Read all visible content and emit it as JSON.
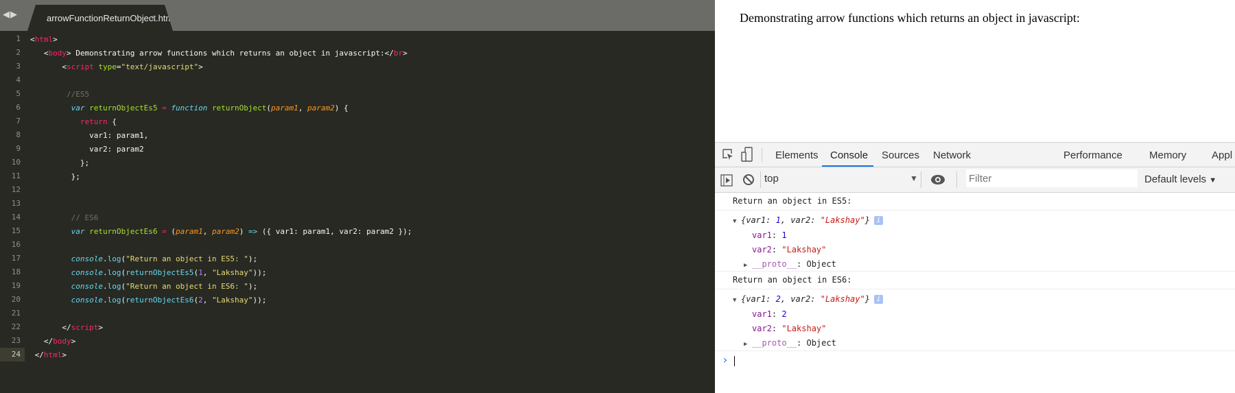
{
  "editor": {
    "tab_title": "arrowFunctionReturnObject.html",
    "close_glyph": "×",
    "nav_glyph": "◀▶",
    "current_line": 24,
    "lines": [
      [
        [
          "<",
          "src"
        ],
        [
          "html",
          "tag"
        ],
        [
          ">",
          "src"
        ]
      ],
      [
        [
          "   <",
          "src"
        ],
        [
          "body",
          "tag"
        ],
        [
          "> Demonstrating arrow functions which returns an object in javascript:</",
          "src"
        ],
        [
          "br",
          "tag"
        ],
        [
          ">",
          "src"
        ]
      ],
      [
        [
          "       <",
          "src"
        ],
        [
          "script",
          "tag"
        ],
        [
          " ",
          "src"
        ],
        [
          "type",
          "attr"
        ],
        [
          "=",
          "src"
        ],
        [
          "\"text/javascript\"",
          "str"
        ],
        [
          ">",
          "src"
        ]
      ],
      [],
      [
        [
          "        //ES5",
          "cmt"
        ]
      ],
      [
        [
          "         ",
          "src"
        ],
        [
          "var",
          "kw"
        ],
        [
          " ",
          "src"
        ],
        [
          "returnObjectEs5",
          "fn"
        ],
        [
          " ",
          "src"
        ],
        [
          "=",
          "op"
        ],
        [
          " ",
          "src"
        ],
        [
          "function",
          "kw"
        ],
        [
          " ",
          "src"
        ],
        [
          "returnObject",
          "fn"
        ],
        [
          "(",
          "src"
        ],
        [
          "param1",
          "prm"
        ],
        [
          ", ",
          "src"
        ],
        [
          "param2",
          "prm"
        ],
        [
          ") {",
          "src"
        ]
      ],
      [
        [
          "           ",
          "src"
        ],
        [
          "return",
          "ret"
        ],
        [
          " {",
          "src"
        ]
      ],
      [
        [
          "             var1: param1,",
          "src"
        ]
      ],
      [
        [
          "             var2: param2",
          "src"
        ]
      ],
      [
        [
          "           };",
          "src"
        ]
      ],
      [
        [
          "         };",
          "src"
        ]
      ],
      [],
      [],
      [
        [
          "         // ES6",
          "cmt"
        ]
      ],
      [
        [
          "         ",
          "src"
        ],
        [
          "var",
          "kw"
        ],
        [
          " ",
          "src"
        ],
        [
          "returnObjectEs6",
          "fn"
        ],
        [
          " ",
          "src"
        ],
        [
          "=",
          "op"
        ],
        [
          " (",
          "src"
        ],
        [
          "param1",
          "prm"
        ],
        [
          ", ",
          "src"
        ],
        [
          "param2",
          "prm"
        ],
        [
          ") ",
          "src"
        ],
        [
          "=>",
          "arrow"
        ],
        [
          " ({ var1: param1, var2: param2 });",
          "src"
        ]
      ],
      [],
      [
        [
          "         ",
          "src"
        ],
        [
          "console",
          "kw"
        ],
        [
          ".",
          "src"
        ],
        [
          "log",
          "call"
        ],
        [
          "(",
          "src"
        ],
        [
          "\"Return an object in ES5: \"",
          "str"
        ],
        [
          ");",
          "src"
        ]
      ],
      [
        [
          "         ",
          "src"
        ],
        [
          "console",
          "kw"
        ],
        [
          ".",
          "src"
        ],
        [
          "log",
          "call"
        ],
        [
          "(",
          "src"
        ],
        [
          "returnObjectEs5",
          "call"
        ],
        [
          "(",
          "src"
        ],
        [
          "1",
          "num2"
        ],
        [
          ", ",
          "src"
        ],
        [
          "\"Lakshay\"",
          "str"
        ],
        [
          "));",
          "src"
        ]
      ],
      [
        [
          "         ",
          "src"
        ],
        [
          "console",
          "kw"
        ],
        [
          ".",
          "src"
        ],
        [
          "log",
          "call"
        ],
        [
          "(",
          "src"
        ],
        [
          "\"Return an object in ES6: \"",
          "str"
        ],
        [
          ");",
          "src"
        ]
      ],
      [
        [
          "         ",
          "src"
        ],
        [
          "console",
          "kw"
        ],
        [
          ".",
          "src"
        ],
        [
          "log",
          "call"
        ],
        [
          "(",
          "src"
        ],
        [
          "returnObjectEs6",
          "call"
        ],
        [
          "(",
          "src"
        ],
        [
          "2",
          "num2"
        ],
        [
          ", ",
          "src"
        ],
        [
          "\"Lakshay\"",
          "str"
        ],
        [
          "));",
          "src"
        ]
      ],
      [],
      [
        [
          "       </",
          "src"
        ],
        [
          "script",
          "tag"
        ],
        [
          ">",
          "src"
        ]
      ],
      [
        [
          "   </",
          "src"
        ],
        [
          "body",
          "tag"
        ],
        [
          ">",
          "src"
        ]
      ],
      [
        [
          " </",
          "src"
        ],
        [
          "html",
          "tag"
        ],
        [
          ">",
          "src"
        ]
      ]
    ]
  },
  "browser": {
    "page_text": "Demonstrating arrow functions which returns an object in javascript:",
    "devtools": {
      "tabs": [
        "Elements",
        "Console",
        "Sources",
        "Network",
        "Performance",
        "Memory",
        "Appl"
      ],
      "active_tab": "Console",
      "context": "top",
      "filter_placeholder": "Filter",
      "levels": "Default levels",
      "dropdown_glyph": "▼",
      "prompt": "›",
      "logs": [
        {
          "message": "Return an object in ES5:",
          "object": {
            "var1": "1",
            "var2": "\"Lakshay\""
          },
          "proto_key": "__proto__",
          "proto_val": ": Object"
        },
        {
          "message": "Return an object in ES6:",
          "object": {
            "var1": "2",
            "var2": "\"Lakshay\""
          },
          "proto_key": "__proto__",
          "proto_val": ": Object"
        }
      ]
    }
  }
}
